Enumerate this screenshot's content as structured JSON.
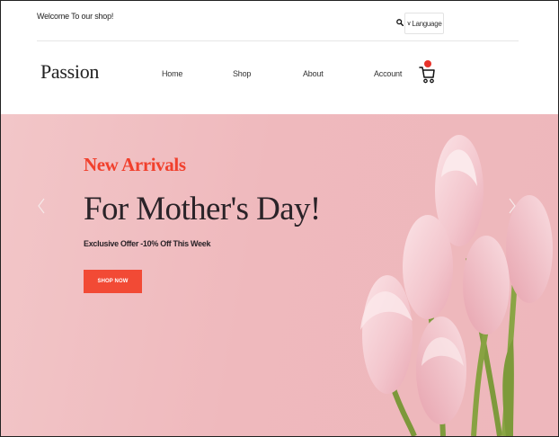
{
  "topbar": {
    "welcome_text": "Welcome To our shop!",
    "language_label": "Language"
  },
  "header": {
    "logo": "Passion",
    "nav": [
      {
        "label": "Home"
      },
      {
        "label": "Shop"
      },
      {
        "label": "About"
      },
      {
        "label": "Account"
      }
    ]
  },
  "hero": {
    "kicker": "New Arrivals",
    "headline": "For Mother's Day!",
    "subline": "Exclusive Offer -10% Off This Week",
    "button_label": "SHOP NOW"
  },
  "colors": {
    "accent": "#f24a35",
    "hero_bg": "#efbabe",
    "text_dark": "#2a2328"
  }
}
